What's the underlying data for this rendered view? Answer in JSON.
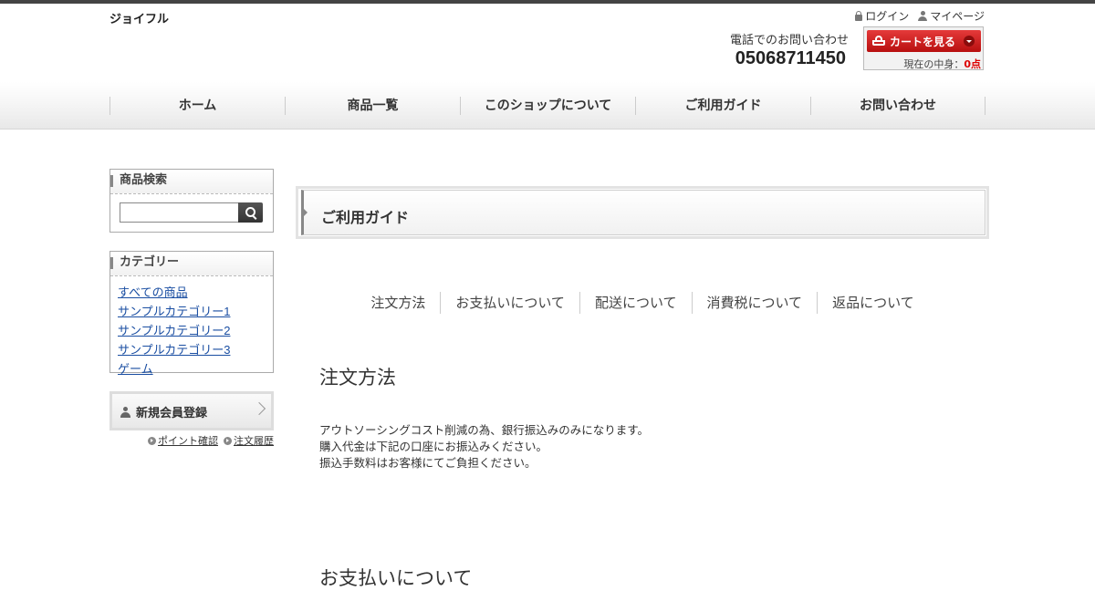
{
  "header": {
    "shop_name": "ジョイフル",
    "login_label": "ログイン",
    "mypage_label": "マイページ",
    "phone_label": "電話でのお問い合わせ",
    "phone_number": "05068711450",
    "cart": {
      "button_label": "カートを見る",
      "count_prefix": "現在の中身：",
      "count_value": "0点"
    }
  },
  "global_nav": [
    {
      "label": "ホーム"
    },
    {
      "label": "商品一覧"
    },
    {
      "label": "このショップについて"
    },
    {
      "label": "ご利用ガイド"
    },
    {
      "label": "お問い合わせ"
    }
  ],
  "sidebar": {
    "search": {
      "title": "商品検索",
      "value": "",
      "placeholder": ""
    },
    "category": {
      "title": "カテゴリー",
      "items": [
        {
          "label": "すべての商品"
        },
        {
          "label": "サンプルカテゴリー1"
        },
        {
          "label": "サンプルカテゴリー2"
        },
        {
          "label": "サンプルカテゴリー3"
        },
        {
          "label": "ゲーム"
        }
      ]
    },
    "register_label": "新規会員登録",
    "point_link": "ポイント確認",
    "order_link": "注文履歴"
  },
  "main": {
    "page_title": "ご利用ガイド",
    "tabs": [
      {
        "label": "注文方法"
      },
      {
        "label": "お支払いについて"
      },
      {
        "label": "配送について"
      },
      {
        "label": "消費税について"
      },
      {
        "label": "返品について"
      }
    ],
    "sections": [
      {
        "title": "注文方法",
        "lines": [
          "アウトソーシングコスト削減の為、銀行振込みのみになります。",
          "購入代金は下記の口座にお振込みください。",
          "振込手数料はお客様にてご負担ください。"
        ]
      },
      {
        "title": "お支払いについて"
      }
    ]
  }
}
